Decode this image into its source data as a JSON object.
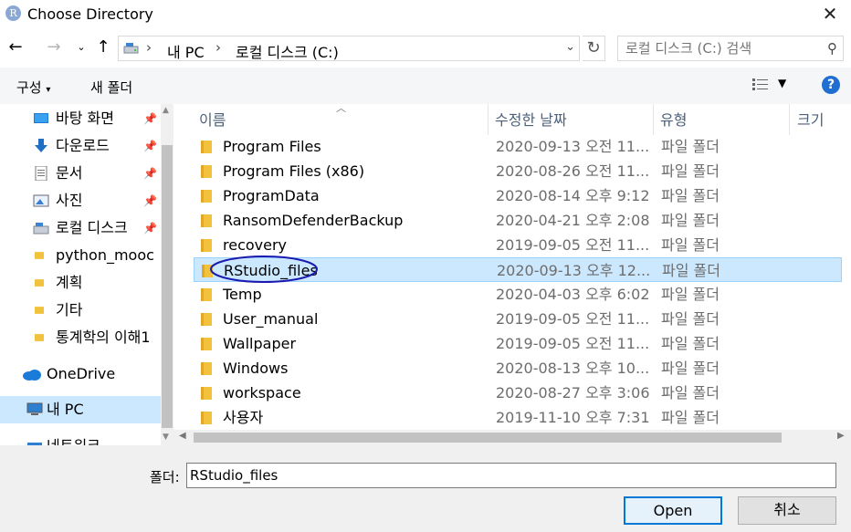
{
  "window": {
    "title": "Choose Directory",
    "app_icon_letter": "R"
  },
  "nav": {
    "back_icon": "arrow-left-icon",
    "forward_icon": "arrow-right-icon",
    "up_icon": "arrow-up-icon",
    "breadcrumb": [
      "내 PC",
      "로컬 디스크 (C:)"
    ],
    "search_placeholder": "로컬 디스크 (C:) 검색"
  },
  "toolbar": {
    "organize_label": "구성",
    "new_folder_label": "새 폴더"
  },
  "sidebar": {
    "items": [
      {
        "label": "바탕 화면",
        "icon": "desktop-icon",
        "pinned": true
      },
      {
        "label": "다운로드",
        "icon": "download-icon",
        "pinned": true
      },
      {
        "label": "문서",
        "icon": "document-icon",
        "pinned": true
      },
      {
        "label": "사진",
        "icon": "picture-icon",
        "pinned": true
      },
      {
        "label": "로컬 디스크",
        "icon": "drive-icon",
        "pinned": true
      },
      {
        "label": "python_mooc",
        "icon": "folder-icon",
        "pinned": false
      },
      {
        "label": "계획",
        "icon": "folder-icon",
        "pinned": false
      },
      {
        "label": "기타",
        "icon": "folder-icon",
        "pinned": false
      },
      {
        "label": "통계학의 이해1",
        "icon": "folder-icon",
        "pinned": false
      },
      {
        "label": "OneDrive",
        "icon": "cloud-icon",
        "pinned": false
      },
      {
        "label": "내 PC",
        "icon": "pc-icon",
        "pinned": false,
        "selected": true
      },
      {
        "label": "네트워크",
        "icon": "network-icon",
        "pinned": false
      }
    ]
  },
  "columns": {
    "name": "이름",
    "date": "수정한 날짜",
    "type": "유형",
    "size": "크기"
  },
  "files": [
    {
      "name": "Program Files",
      "date": "2020-09-13 오전 11...",
      "type": "파일 폴더"
    },
    {
      "name": "Program Files (x86)",
      "date": "2020-08-26 오전 11...",
      "type": "파일 폴더"
    },
    {
      "name": "ProgramData",
      "date": "2020-08-14 오후 9:12",
      "type": "파일 폴더"
    },
    {
      "name": "RansomDefenderBackup",
      "date": "2020-04-21 오후 2:08",
      "type": "파일 폴더"
    },
    {
      "name": "recovery",
      "date": "2019-09-05 오전 11...",
      "type": "파일 폴더"
    },
    {
      "name": "RStudio_files",
      "date": "2020-09-13 오후 12...",
      "type": "파일 폴더",
      "selected": true
    },
    {
      "name": "Temp",
      "date": "2020-04-03 오후 6:02",
      "type": "파일 폴더"
    },
    {
      "name": "User_manual",
      "date": "2019-09-05 오전 11...",
      "type": "파일 폴더"
    },
    {
      "name": "Wallpaper",
      "date": "2019-09-05 오전 11...",
      "type": "파일 폴더"
    },
    {
      "name": "Windows",
      "date": "2020-08-13 오후 10...",
      "type": "파일 폴더"
    },
    {
      "name": "workspace",
      "date": "2020-08-27 오후 3:06",
      "type": "파일 폴더"
    },
    {
      "name": "사용자",
      "date": "2019-11-10 오후 7:31",
      "type": "파일 폴더"
    }
  ],
  "footer": {
    "folder_label": "폴더:",
    "folder_value": "RStudio_files",
    "open_label": "Open",
    "cancel_label": "취소"
  },
  "colors": {
    "selection": "#cce8ff",
    "accent": "#0078d7",
    "annotation": "#1a1ab0",
    "folder": "#f3c23c"
  }
}
